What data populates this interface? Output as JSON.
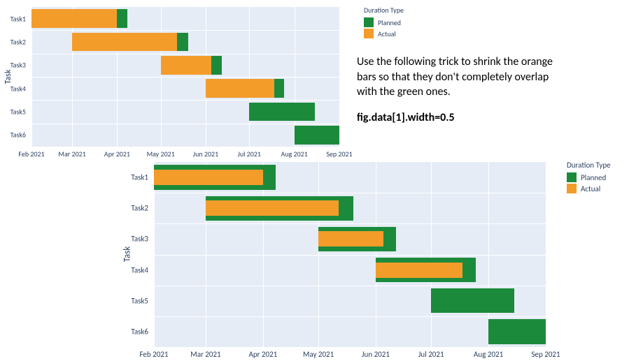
{
  "text": {
    "annotation_line1": "Use the following trick to shrink the orange",
    "annotation_line2": "bars so that they don't completely overlap",
    "annotation_line3": "with the green ones.",
    "annotation_code": "fig.data[1].width=0.5"
  },
  "legend": {
    "title": "Duration Type",
    "planned": "Planned",
    "actual": "Actual"
  },
  "axis": {
    "y_title": "Task",
    "x_ticks": [
      "Feb 2021",
      "Mar 2021",
      "Apr 2021",
      "May 2021",
      "Jun 2021",
      "Jul 2021",
      "Aug 2021",
      "Sep 2021"
    ],
    "y_categories": [
      "Task1",
      "Task2",
      "Task3",
      "Task4",
      "Task5",
      "Task6"
    ]
  },
  "chart_data": [
    {
      "id": "top",
      "type": "bar",
      "orientation": "horizontal_gantt",
      "title": "",
      "xlabel": "",
      "ylabel": "Task",
      "xtype": "date",
      "xlim": [
        "2021-02-01",
        "2021-09-01"
      ],
      "categories": [
        "Task1",
        "Task2",
        "Task3",
        "Task4",
        "Task5",
        "Task6"
      ],
      "series": [
        {
          "name": "Planned",
          "color": "#1c8a3b",
          "bar_width_fraction": 0.8,
          "values": [
            {
              "start": "2021-02-01",
              "end": "2021-04-08"
            },
            {
              "start": "2021-03-01",
              "end": "2021-05-20"
            },
            {
              "start": "2021-05-01",
              "end": "2021-06-12"
            },
            {
              "start": "2021-06-01",
              "end": "2021-07-25"
            },
            {
              "start": "2021-07-01",
              "end": "2021-08-15"
            },
            {
              "start": "2021-08-01",
              "end": "2021-09-01"
            }
          ]
        },
        {
          "name": "Actual",
          "color": "#f39c2a",
          "bar_width_fraction": 0.8,
          "values": [
            {
              "start": "2021-02-01",
              "end": "2021-04-01"
            },
            {
              "start": "2021-03-01",
              "end": "2021-05-12"
            },
            {
              "start": "2021-05-01",
              "end": "2021-06-05"
            },
            {
              "start": "2021-06-01",
              "end": "2021-07-18"
            },
            null,
            null
          ]
        }
      ]
    },
    {
      "id": "bottom",
      "type": "bar",
      "orientation": "horizontal_gantt",
      "title": "",
      "xlabel": "",
      "ylabel": "Task",
      "xtype": "date",
      "xlim": [
        "2021-02-01",
        "2021-09-01"
      ],
      "categories": [
        "Task1",
        "Task2",
        "Task3",
        "Task4",
        "Task5",
        "Task6"
      ],
      "series": [
        {
          "name": "Planned",
          "color": "#1c8a3b",
          "bar_width_fraction": 0.8,
          "values": [
            {
              "start": "2021-02-01",
              "end": "2021-04-08"
            },
            {
              "start": "2021-03-01",
              "end": "2021-05-20"
            },
            {
              "start": "2021-05-01",
              "end": "2021-06-12"
            },
            {
              "start": "2021-06-01",
              "end": "2021-07-25"
            },
            {
              "start": "2021-07-01",
              "end": "2021-08-15"
            },
            {
              "start": "2021-08-01",
              "end": "2021-09-01"
            }
          ]
        },
        {
          "name": "Actual",
          "color": "#f39c2a",
          "bar_width_fraction": 0.5,
          "values": [
            {
              "start": "2021-02-01",
              "end": "2021-04-01"
            },
            {
              "start": "2021-03-01",
              "end": "2021-05-12"
            },
            {
              "start": "2021-05-01",
              "end": "2021-06-05"
            },
            {
              "start": "2021-06-01",
              "end": "2021-07-18"
            },
            null,
            null
          ]
        }
      ]
    }
  ]
}
